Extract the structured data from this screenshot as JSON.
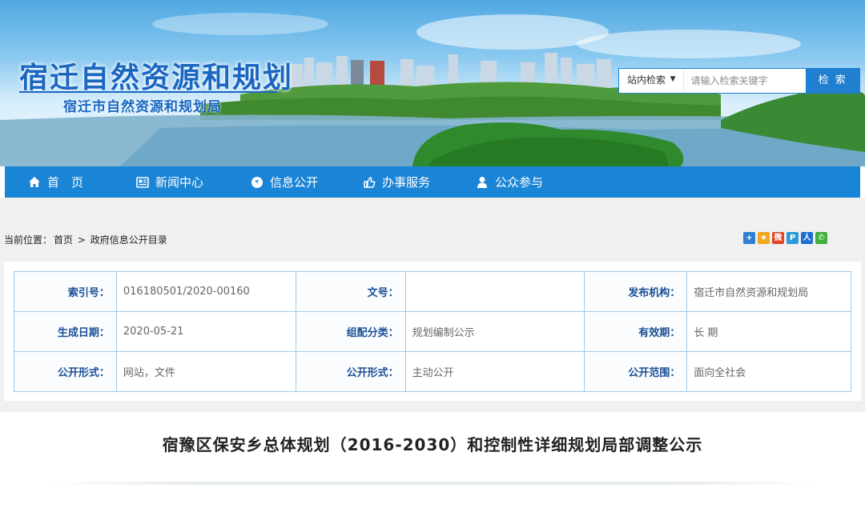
{
  "site": {
    "title": "宿迁自然资源和规划",
    "subtitle": "宿迁市自然资源和规划局"
  },
  "search": {
    "scope_label": "站内检索",
    "scope_caret": "▼",
    "placeholder": "请输入检索关键字",
    "button_label": "检 索"
  },
  "nav": {
    "items": [
      {
        "label": "首　页",
        "icon": "home-icon"
      },
      {
        "label": "新闻中心",
        "icon": "newspaper-icon"
      },
      {
        "label": "信息公开",
        "icon": "info-circle-icon"
      },
      {
        "label": "办事服务",
        "icon": "thumbs-up-icon"
      },
      {
        "label": "公众参与",
        "icon": "user-icon"
      }
    ]
  },
  "breadcrumb": {
    "prefix": "当前位置：",
    "home": "首页",
    "separator": ">",
    "current": "政府信息公开目录"
  },
  "share": {
    "icons": [
      {
        "name": "share-more-icon",
        "glyph": "+",
        "color": "#2d7fd2"
      },
      {
        "name": "share-qzone-icon",
        "glyph": "★",
        "color": "#f0a81c"
      },
      {
        "name": "share-weibo-icon",
        "glyph": "微",
        "color": "#e0452b"
      },
      {
        "name": "share-tencent-weibo-icon",
        "glyph": "P",
        "color": "#2a9bd8"
      },
      {
        "name": "share-renren-icon",
        "glyph": "人",
        "color": "#1b6ed4"
      },
      {
        "name": "share-wechat-icon",
        "glyph": "✆",
        "color": "#3fb03a"
      }
    ]
  },
  "meta": {
    "rows": [
      [
        {
          "key": "索引号：",
          "value": "016180501/2020-00160"
        },
        {
          "key": "文号：",
          "value": ""
        },
        {
          "key": "发布机构：",
          "value": "宿迁市自然资源和规划局"
        }
      ],
      [
        {
          "key": "生成日期：",
          "value": "2020-05-21"
        },
        {
          "key": "组配分类：",
          "value": "规划编制公示"
        },
        {
          "key": "有效期：",
          "value": "长 期"
        }
      ],
      [
        {
          "key": "公开形式：",
          "value": "网站，文件"
        },
        {
          "key": "公开形式：",
          "value": "主动公开"
        },
        {
          "key": "公开范围：",
          "value": "面向全社会"
        }
      ]
    ]
  },
  "article": {
    "title": "宿豫区保安乡总体规划（2016-2030）和控制性详细规划局部调整公示"
  },
  "colors": {
    "brand_blue": "#1a84d6",
    "title_blue": "#1a66c0",
    "table_border": "#9cc9ea"
  }
}
